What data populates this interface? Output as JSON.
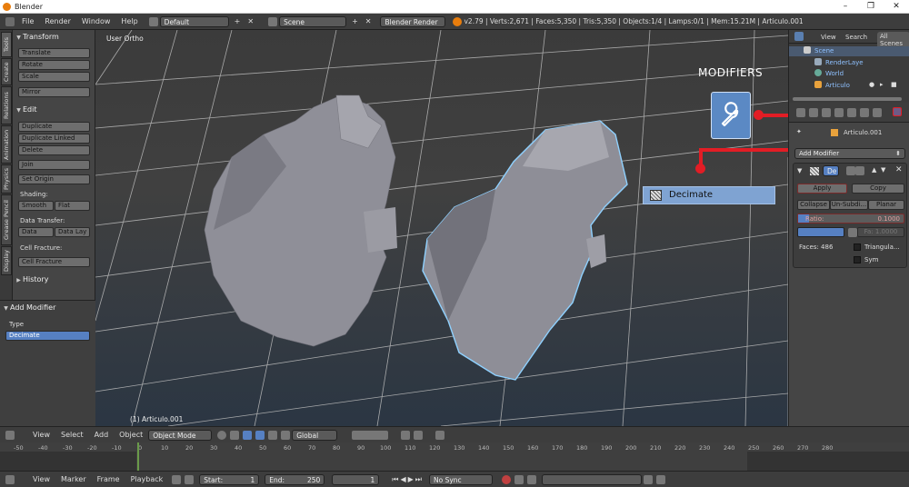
{
  "window": {
    "title": "Blender",
    "min": "–",
    "max": "❐",
    "close": "✕"
  },
  "info_header": {
    "menus": [
      "File",
      "Render",
      "Window",
      "Help"
    ],
    "screen_layout": "Default",
    "scene": "Scene",
    "engine": "Blender Render",
    "stats": "v2.79 | Verts:2,671 | Faces:5,350 | Tris:5,350 | Objects:1/4 | Lamps:0/1 | Mem:15.21M | Articulo.001"
  },
  "left_tabs": [
    "Tools",
    "Create",
    "Relations",
    "Animation",
    "Physics",
    "Grease Pencil",
    "Display"
  ],
  "tool_shelf": {
    "transform": {
      "title": "Transform",
      "buttons": [
        "Translate",
        "Rotate",
        "Scale",
        "Mirror"
      ]
    },
    "edit": {
      "title": "Edit",
      "buttons": [
        "Duplicate",
        "Duplicate Linked",
        "Delete",
        "Join",
        "Set Origin"
      ],
      "shading_label": "Shading:",
      "smooth": "Smooth",
      "flat": "Flat",
      "data_transfer_label": "Data Transfer:",
      "data": "Data",
      "data_lay": "Data Lay",
      "cell_fracture_label": "Cell Fracture:",
      "cell_fracture": "Cell Fracture"
    },
    "history": {
      "title": "History"
    }
  },
  "operator_panel": {
    "title": "Add Modifier",
    "type_label": "Type",
    "type_value": "Decimate"
  },
  "viewport": {
    "view_label": "User Ortho",
    "object_label": "(1) Articulo.001"
  },
  "overlay": {
    "modifiers_label": "MODIFIERS",
    "decimate_label": "Decimate"
  },
  "outliner": {
    "tabs": [
      "View",
      "Search",
      "All Scenes"
    ],
    "items": [
      {
        "label": "Scene"
      },
      {
        "label": "RenderLaye"
      },
      {
        "label": "World"
      },
      {
        "label": "Articulo"
      }
    ]
  },
  "properties": {
    "object_name": "Articulo.001",
    "add_modifier": "Add Modifier",
    "modifier_name": "De",
    "apply": "Apply",
    "copy": "Copy",
    "modes": [
      "Collapse",
      "Un-Subdi...",
      "Planar"
    ],
    "ratio_label": "Ratio:",
    "ratio_value": "0.1000",
    "fa_value": "Fa: 1.0000",
    "faces": "Faces: 486",
    "triangulate": "Triangula...",
    "sym": "Sym"
  },
  "viewport_header": {
    "menus": [
      "View",
      "Select",
      "Add",
      "Object"
    ],
    "mode": "Object Mode",
    "orientation": "Global"
  },
  "timeline": {
    "ticks": [
      "-50",
      "-40",
      "-30",
      "-20",
      "-10",
      "0",
      "10",
      "20",
      "30",
      "40",
      "50",
      "60",
      "70",
      "80",
      "90",
      "100",
      "110",
      "120",
      "130",
      "140",
      "150",
      "160",
      "170",
      "180",
      "190",
      "200",
      "210",
      "220",
      "230",
      "240",
      "250",
      "260",
      "270",
      "280"
    ],
    "menus": [
      "View",
      "Marker",
      "Frame",
      "Playback"
    ],
    "start_label": "Start:",
    "start_value": "1",
    "end_label": "End:",
    "end_value": "250",
    "current": "1",
    "sync": "No Sync"
  },
  "colors": {
    "accent": "#5680c2",
    "highlight_red": "#e21d25",
    "selection_outline": "#8fd1ff"
  }
}
